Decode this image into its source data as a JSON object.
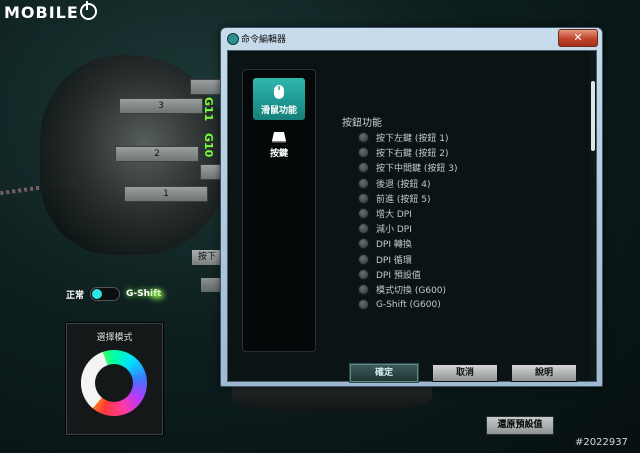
{
  "logo": {
    "text": "MOBILE"
  },
  "background": {
    "button_labels": [
      "3",
      "2",
      "1"
    ],
    "g_labels": [
      "G11",
      "G10"
    ],
    "press_label": "按下"
  },
  "toggle": {
    "left_label": "正常",
    "right_label": "G-Shift",
    "knob_color": "#2ee6e6"
  },
  "mode_panel": {
    "title": "選擇模式"
  },
  "restore_button": "還原預設值",
  "watermark": "#2022937",
  "dialog": {
    "title": "命令編輯器",
    "close_glyph": "✕",
    "sidebar": [
      {
        "label": "滑鼠功能",
        "icon": "mouse-icon",
        "active": true
      },
      {
        "label": "按鍵",
        "icon": "key-icon",
        "active": false
      }
    ],
    "section_title": "按鈕功能",
    "functions": [
      "按下左鍵 (按鈕 1)",
      "按下右鍵 (按鈕 2)",
      "按下中間鍵 (按鈕 3)",
      "後退 (按鈕 4)",
      "前進 (按鈕 5)",
      "增大 DPI",
      "減小 DPI",
      "DPI 轉換",
      "DPI 循環",
      "DPI 預設值",
      "模式切換 (G600)",
      "G-Shift (G600)"
    ],
    "buttons": {
      "ok": "確定",
      "cancel": "取消",
      "help": "說明"
    },
    "accent_color": "#2fb7b0"
  }
}
